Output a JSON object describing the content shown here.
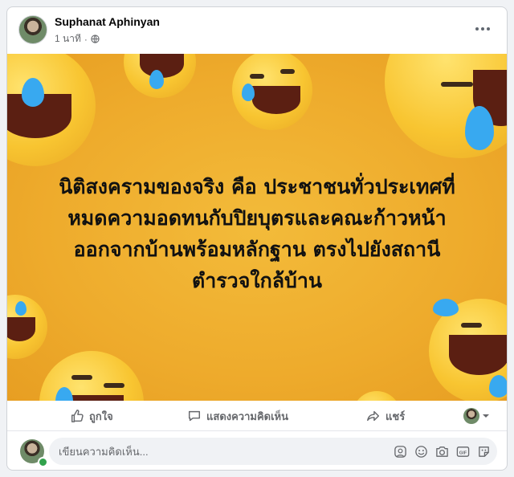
{
  "post": {
    "author": "Suphanat Aphinyan",
    "time": "1 นาที",
    "text_lines": [
      "นิติสงครามของจริง คือ ประชาชนทั่วประเทศที่",
      "หมดความอดทนกับปิยบุตรและคณะก้าวหน้า",
      "ออกจากบ้านพร้อมหลักฐาน ตรงไปยังสถานี",
      "ตำรวจใกล้บ้าน"
    ]
  },
  "actions": {
    "like": "ถูกใจ",
    "comment": "แสดงความคิดเห็น",
    "share": "แชร์"
  },
  "comment_box": {
    "placeholder": "เขียนความคิดเห็น..."
  },
  "icons": {
    "more": "more-dots-icon",
    "privacy": "globe-icon",
    "like": "thumbs-up-icon",
    "comment": "comment-bubble-icon",
    "share": "share-arrow-icon",
    "comment_tools": [
      "avatar-sticker-icon",
      "emoji-icon",
      "camera-icon",
      "gif-icon",
      "sticker-icon"
    ]
  },
  "colors": {
    "background": "#f0f2f5",
    "image_yellow": "#eeab2c",
    "text_secondary": "#65676b",
    "online_green": "#31a24c"
  }
}
